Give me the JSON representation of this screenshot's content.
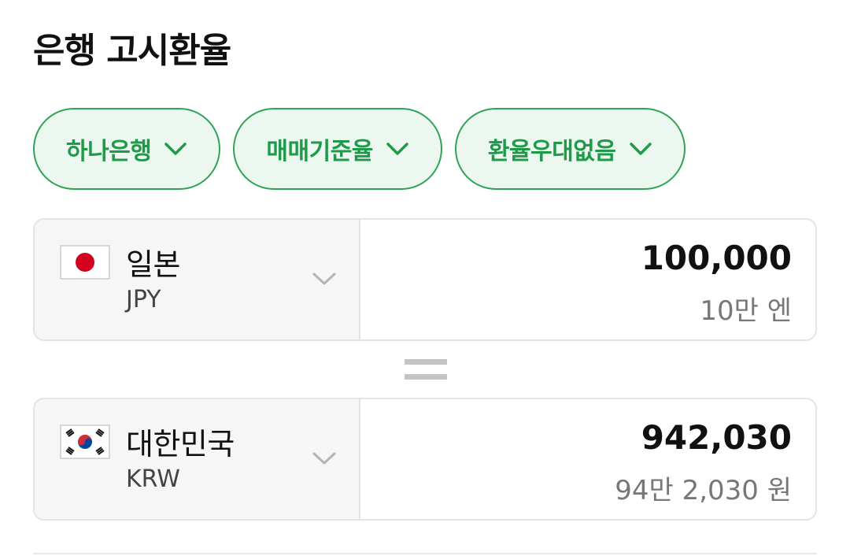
{
  "title": "은행 고시환율",
  "filters": [
    {
      "label": "하나은행",
      "icon": "chevron-down-icon"
    },
    {
      "label": "매매기준율",
      "icon": "chevron-down-icon"
    },
    {
      "label": "환율우대없음",
      "icon": "chevron-down-icon"
    }
  ],
  "from": {
    "country": "일본",
    "code": "JPY",
    "flag_icon": "japan-flag-icon",
    "amount": "100,000",
    "amount_words": "10만 엔"
  },
  "equals_icon": "equals-icon",
  "to": {
    "country": "대한민국",
    "code": "KRW",
    "flag_icon": "korea-flag-icon",
    "amount": "942,030",
    "amount_words": "94만 2,030 원"
  },
  "colors": {
    "accent": "#1f9a4a",
    "chip_border": "#2fa458",
    "chip_bg": "#ecf8ef"
  }
}
